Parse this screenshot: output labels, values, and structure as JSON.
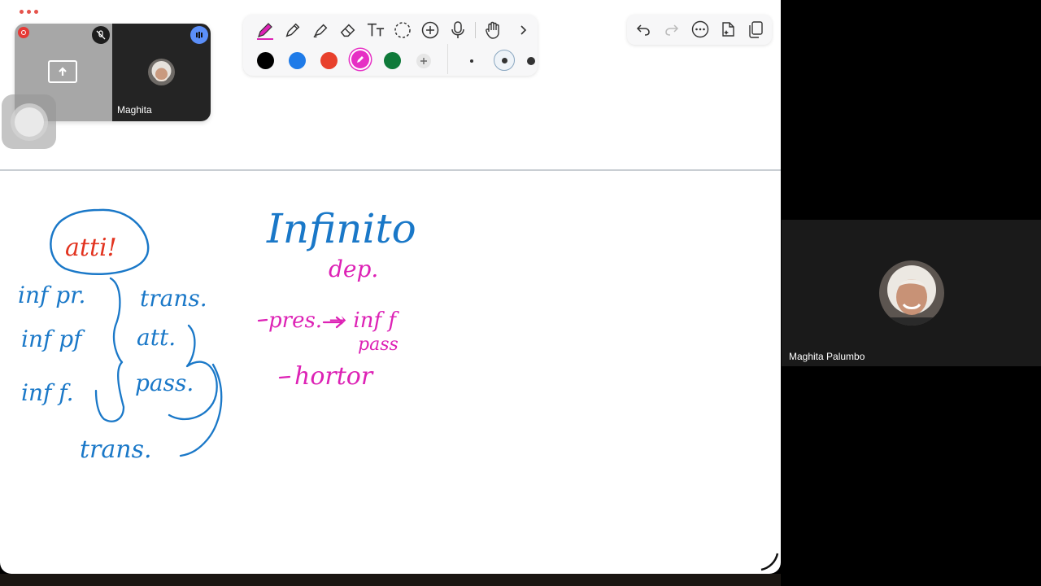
{
  "pip": {
    "participant_name": "Maghita"
  },
  "participant_panel": {
    "name": "Maghita Palumbo"
  },
  "palette": {
    "tools": [
      "pen-icon",
      "pencil-icon",
      "highlighter-icon",
      "eraser-icon",
      "text-icon",
      "lasso-icon",
      "add-icon",
      "microphone-icon",
      "hand-icon",
      "chevron-right-icon"
    ],
    "colors": [
      "#000000",
      "#1f7be8",
      "#e8402c",
      "#e62fc4",
      "#0f7a3a"
    ],
    "selected_color": "#e62fc4"
  },
  "actions": [
    "undo-icon",
    "redo-icon",
    "more-icon",
    "new-page-icon",
    "duplicate-icon"
  ],
  "notes": {
    "circled": "atti!",
    "left": [
      "inf pr.",
      "inf pf",
      "inf f."
    ],
    "right": [
      "trans.",
      "att.",
      "pass."
    ],
    "bottom": "trans.",
    "title": "Infinito",
    "dep": "dep.",
    "line": "pres. → inf f",
    "pass": "pass",
    "hortor": "hortor"
  },
  "ink_colors": {
    "blue": "#1a78c8",
    "red": "#e2331f",
    "magenta": "#dd22b5"
  }
}
